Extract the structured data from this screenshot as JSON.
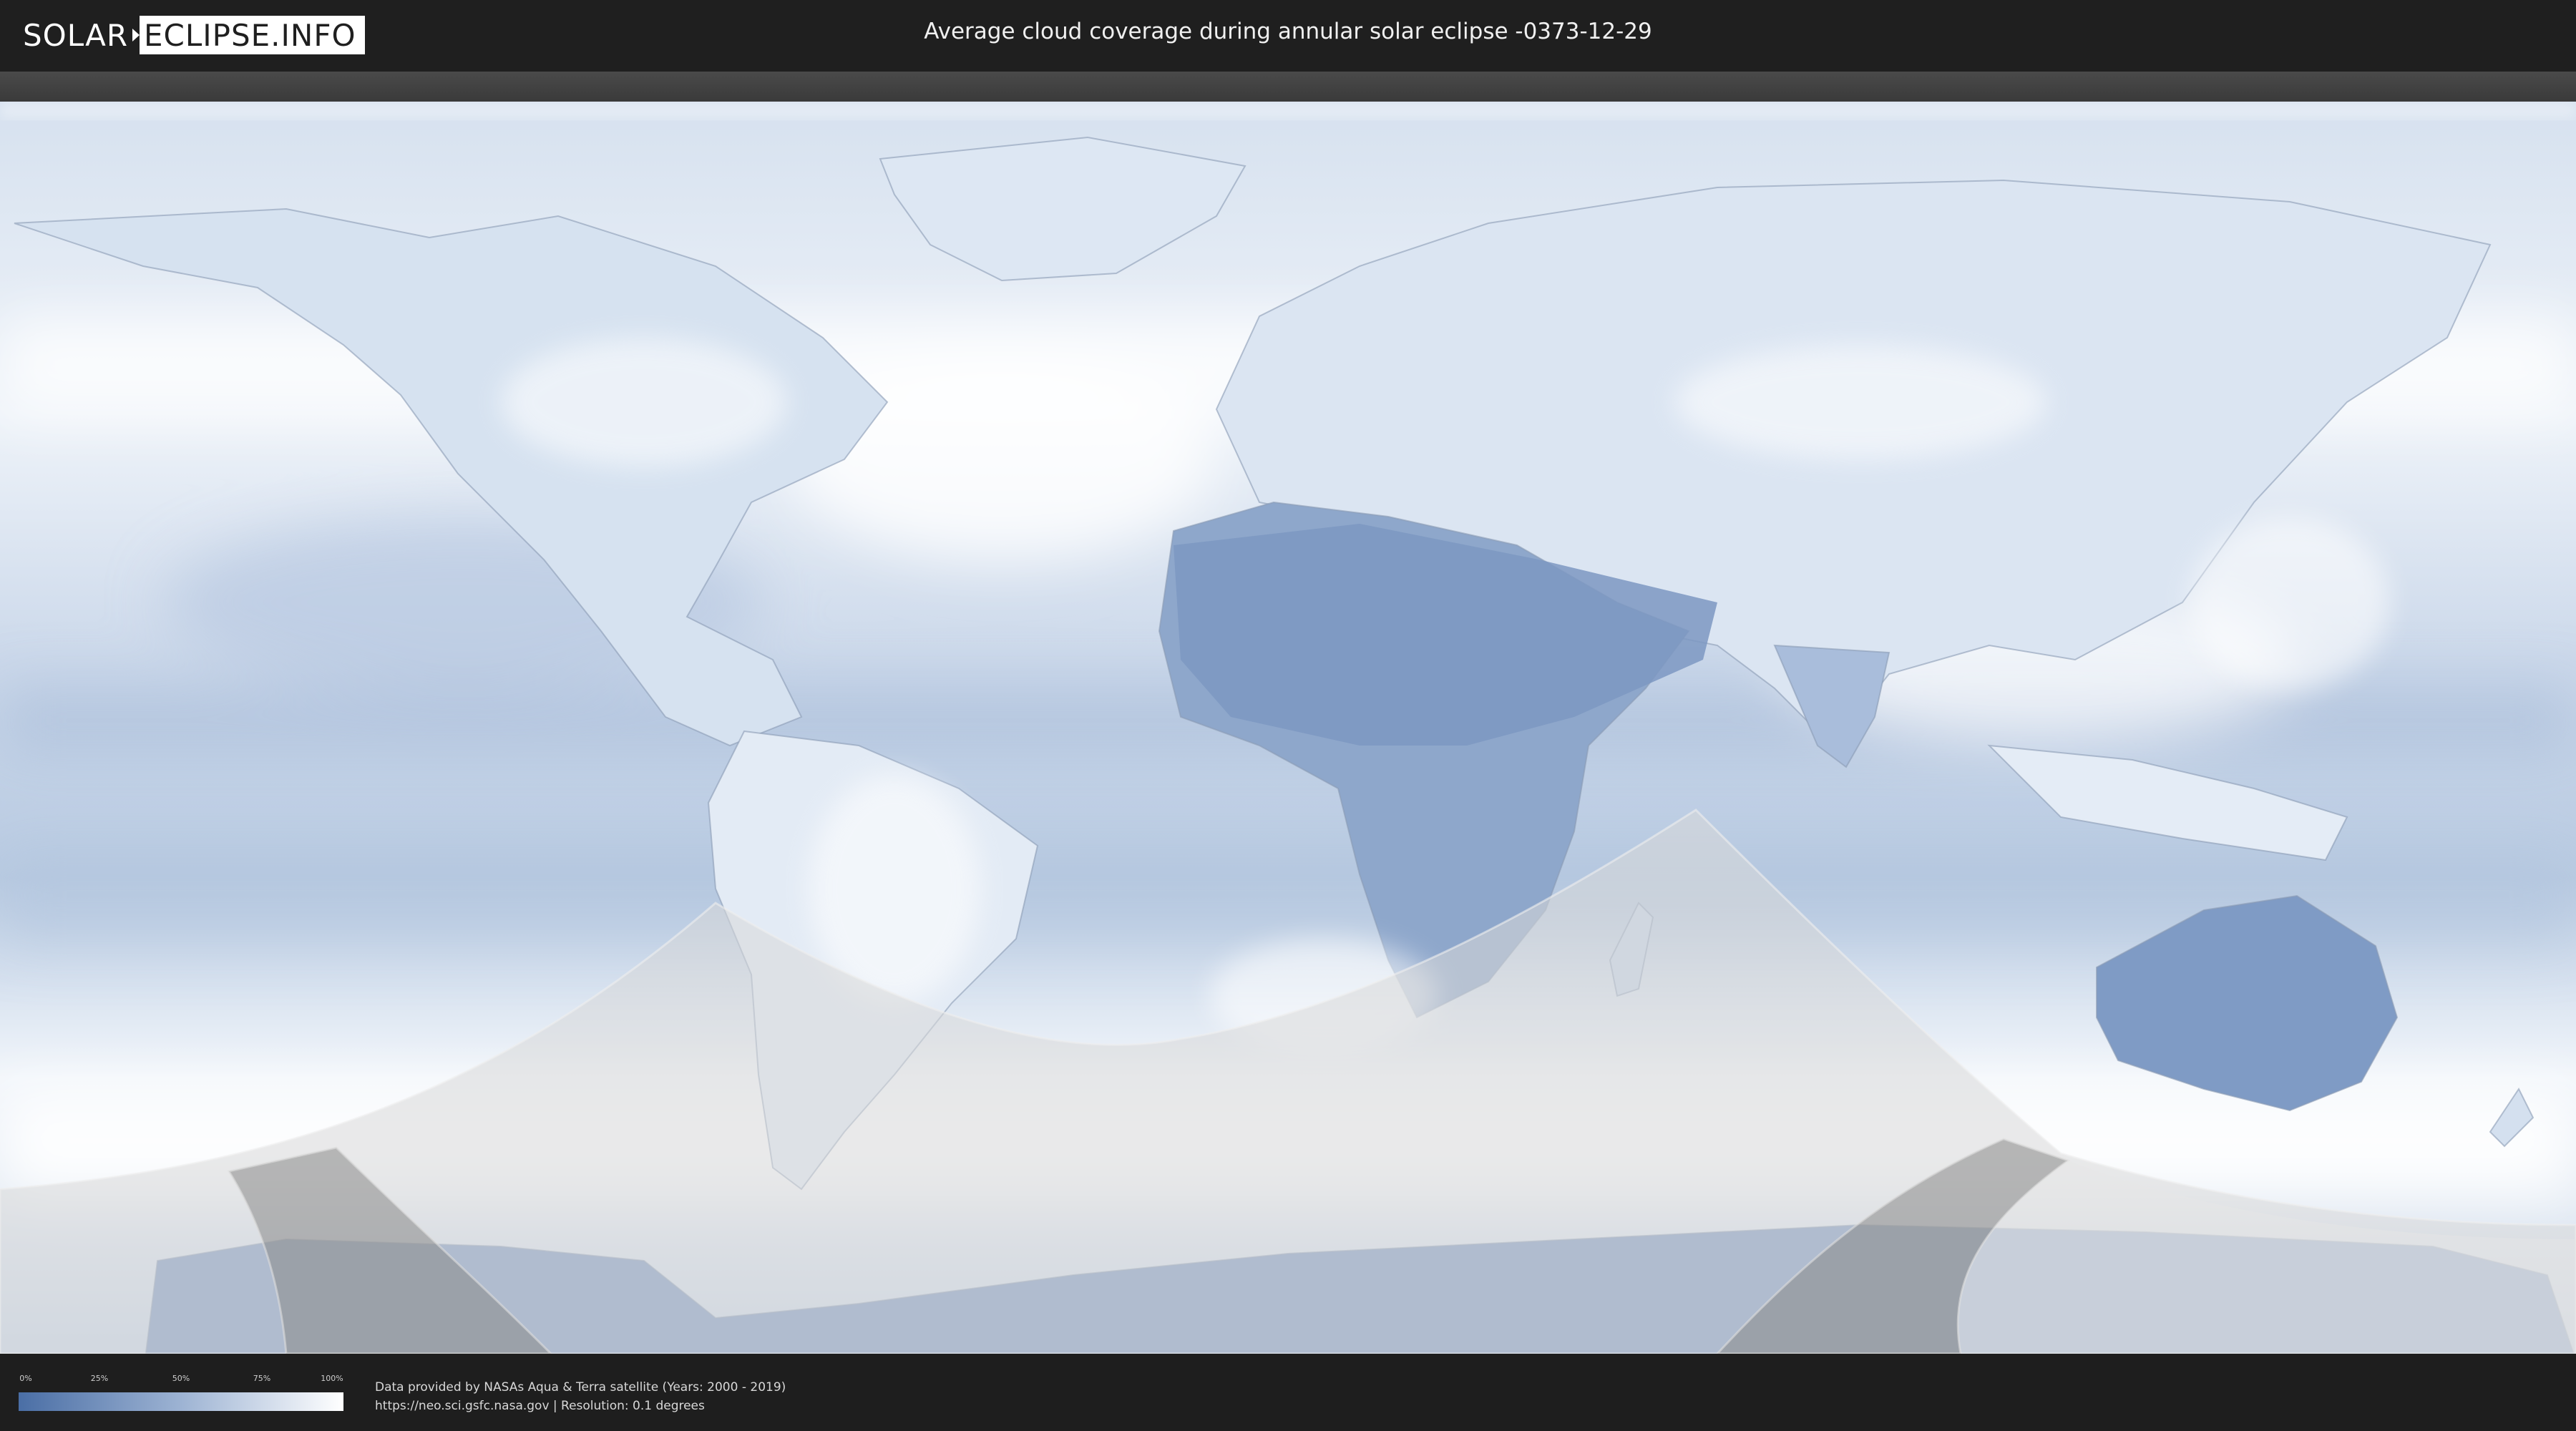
{
  "header": {
    "logo_left": "SOLAR",
    "logo_right": "ECLIPSE.INFO",
    "title": "Average cloud coverage during annular solar eclipse -0373-12-29"
  },
  "legend": {
    "ticks": [
      "0%",
      "25%",
      "50%",
      "75%",
      "100%"
    ],
    "colors": {
      "low": "#4a6ea5",
      "mid": "#9db3d3",
      "high": "#ffffff"
    }
  },
  "credits": {
    "line1": "Data provided by NASAs Aqua & Terra satellite (Years: 2000 - 2019)",
    "line2": "https://neo.sci.gsfc.nasa.gov | Resolution: 0.1 degrees"
  },
  "map": {
    "projection": "equirectangular",
    "layers": [
      "cloud-coverage",
      "coastlines",
      "eclipse-penumbra",
      "annular-path"
    ],
    "ocean_color": "#c4d3e6",
    "land_cloudy_color": "#dfe8f3",
    "clear_color": "#7c98c2",
    "eclipse_overlay_color": "#d8d8d8",
    "annular_path_color": "#8a8a8a"
  }
}
